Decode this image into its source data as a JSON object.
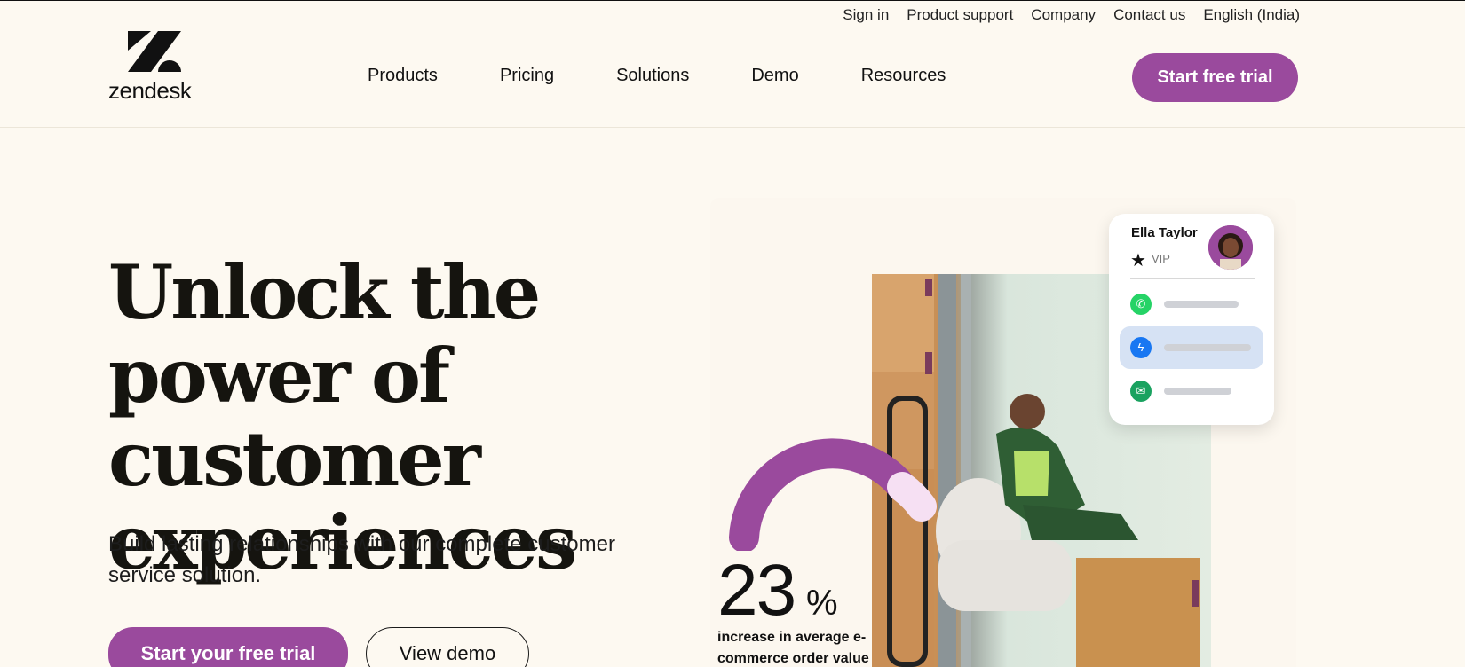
{
  "utility_nav": [
    "Sign in",
    "Product support",
    "Company",
    "Contact us",
    "English (India)"
  ],
  "logo": {
    "wordmark": "zendesk"
  },
  "main_nav": [
    "Products",
    "Pricing",
    "Solutions",
    "Demo",
    "Resources"
  ],
  "nav_cta": "Start free trial",
  "hero": {
    "title": "Unlock the power of customer experiences",
    "subtitle": "Build lasting relationships with our complete customer service solution.",
    "primary_cta": "Start your free trial",
    "secondary_cta": "View demo"
  },
  "stat": {
    "value": "23",
    "unit": "%",
    "description": "increase in average e-commerce order value"
  },
  "profile": {
    "name": "Ella Taylor",
    "tag": "VIP",
    "channels": [
      {
        "icon": "whatsapp-icon",
        "color": "#25d366"
      },
      {
        "icon": "messenger-icon",
        "color": "#1877f2"
      },
      {
        "icon": "email-icon",
        "color": "#1aa260"
      }
    ]
  },
  "colors": {
    "brand": "#9a4a9d",
    "background": "#fdf9f1"
  }
}
